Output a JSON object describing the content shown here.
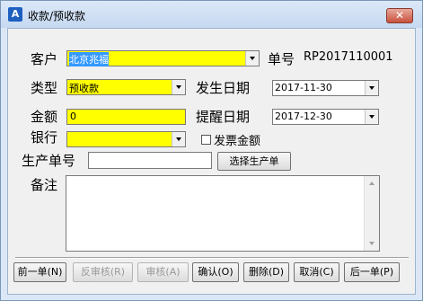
{
  "window": {
    "title": "收款/预收款",
    "app_icon": "A",
    "close_label": "✕"
  },
  "form": {
    "customer": {
      "label": "客户",
      "value": "北京兆福"
    },
    "order_no": {
      "label": "单号",
      "value": "RP2017110001"
    },
    "type": {
      "label": "类型",
      "value": "预收款"
    },
    "occur_date": {
      "label": "发生日期",
      "value": "2017-11-30"
    },
    "amount": {
      "label": "金额",
      "value": "0"
    },
    "remind_date": {
      "label": "提醒日期",
      "value": "2017-12-30"
    },
    "bank": {
      "label": "银行",
      "value": ""
    },
    "invoice_amount": {
      "label": "发票金额",
      "checked": false
    },
    "production_no": {
      "label": "生产单号",
      "value": ""
    },
    "select_production_button": "选择生产单",
    "remark": {
      "label": "备注",
      "value": ""
    }
  },
  "buttons": {
    "prev": "前一单(N)",
    "unaudit": "反审核(R)",
    "audit": "审核(A)",
    "confirm": "确认(O)",
    "delete": "删除(D)",
    "cancel": "取消(C)",
    "next": "后一单(P)"
  },
  "colors": {
    "required_field": "#ffff00",
    "selection": "#3399ff"
  }
}
